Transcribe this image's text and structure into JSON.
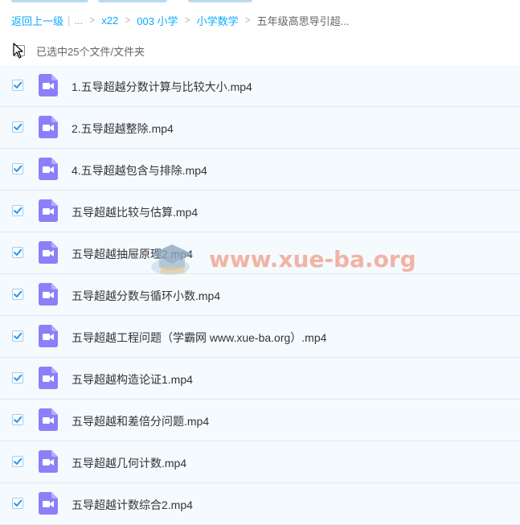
{
  "breadcrumb": {
    "back_label": "返回上一级",
    "ellipsis": "...",
    "crumbs": [
      "x22",
      "003 小学",
      "小学数学"
    ],
    "current": "五年级高思导引超..."
  },
  "selection": {
    "text": "已选中25个文件/文件夹"
  },
  "files": [
    {
      "name": "1.五导超越分数计算与比较大小.mp4",
      "checked": true
    },
    {
      "name": "2.五导超越整除.mp4",
      "checked": true
    },
    {
      "name": "4.五导超越包含与排除.mp4",
      "checked": true
    },
    {
      "name": "五导超越比较与估算.mp4",
      "checked": true
    },
    {
      "name": "五导超越抽屉原理2.mp4",
      "checked": true
    },
    {
      "name": "五导超越分数与循环小数.mp4",
      "checked": true
    },
    {
      "name": "五导超越工程问题（学霸网 www.xue-ba.org）.mp4",
      "checked": true
    },
    {
      "name": "五导超越构造论证1.mp4",
      "checked": true
    },
    {
      "name": "五导超越和差倍分问题.mp4",
      "checked": true
    },
    {
      "name": "五导超越几何计数.mp4",
      "checked": true
    },
    {
      "name": "五导超越计数综合2.mp4",
      "checked": true
    }
  ],
  "watermark": {
    "text": "www.xue-ba.org"
  },
  "colors": {
    "link": "#09aaff",
    "row_bg": "#f5faff",
    "check": "#2196f3",
    "video_icon": "#8b80f9",
    "watermark": "#ee785a"
  },
  "icons": {
    "file_type": "video-file-icon",
    "check": "checkmark-icon",
    "cursor": "mouse-pointer-icon",
    "watermark_logo": "graduation-cap-icon"
  }
}
